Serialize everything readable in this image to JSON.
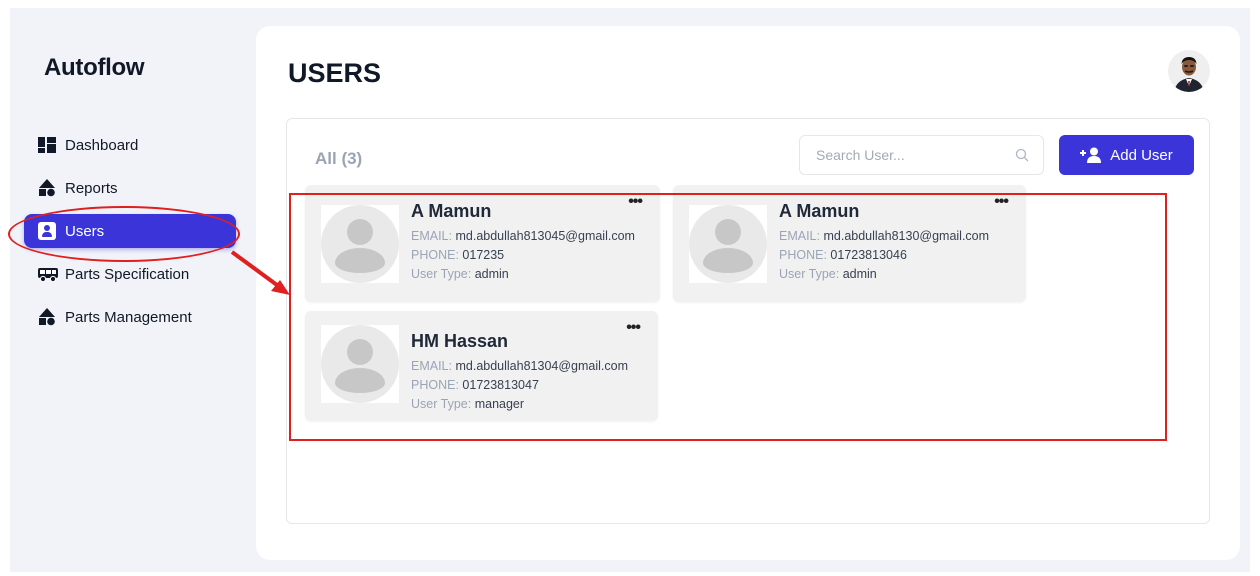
{
  "app": {
    "brand": "Autoflow"
  },
  "sidebar": {
    "items": [
      {
        "label": "Dashboard",
        "icon": "dashboard-icon",
        "active": false
      },
      {
        "label": "Reports",
        "icon": "shapes-icon",
        "active": false
      },
      {
        "label": "Users",
        "icon": "user-icon",
        "active": true
      },
      {
        "label": "Parts Specification",
        "icon": "truck-icon",
        "active": false
      },
      {
        "label": "Parts Management",
        "icon": "shapes-icon",
        "active": false
      }
    ]
  },
  "header": {
    "title": "USERS",
    "avatar": "profile-avatar"
  },
  "toolbar": {
    "count_label": "All (3)",
    "search_placeholder": "Search User...",
    "add_label": "Add User"
  },
  "labels": {
    "email": "EMAIL:",
    "phone": "PHONE:",
    "user_type": "User Type:"
  },
  "users": [
    {
      "name": "A Mamun",
      "email": "md.abdullah813045@gmail.com",
      "phone": "017235",
      "user_type": "admin"
    },
    {
      "name": "A Mamun",
      "email": "md.abdullah8130@gmail.com",
      "phone": "01723813046",
      "user_type": "admin"
    },
    {
      "name": "HM Hassan",
      "email": "md.abdullah81304@gmail.com",
      "phone": "01723813047",
      "user_type": "manager"
    }
  ],
  "colors": {
    "accent": "#3b35d9",
    "page_bg": "#f1f3f9",
    "card_bg": "#f1f1f1",
    "annotation": "#e0201f",
    "muted": "#9aa4b5"
  }
}
